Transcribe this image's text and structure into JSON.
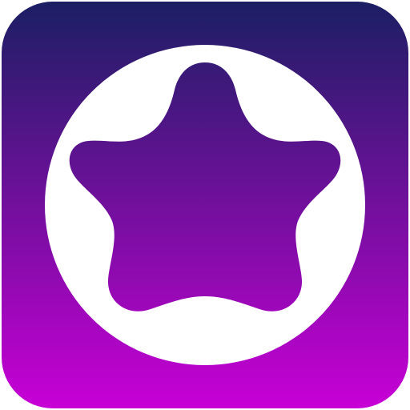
{
  "icon": {
    "name": "star-in-circle-app-icon",
    "gradient_top": "#1b1f63",
    "gradient_bottom": "#c800d6",
    "circle_color": "#ffffff"
  }
}
